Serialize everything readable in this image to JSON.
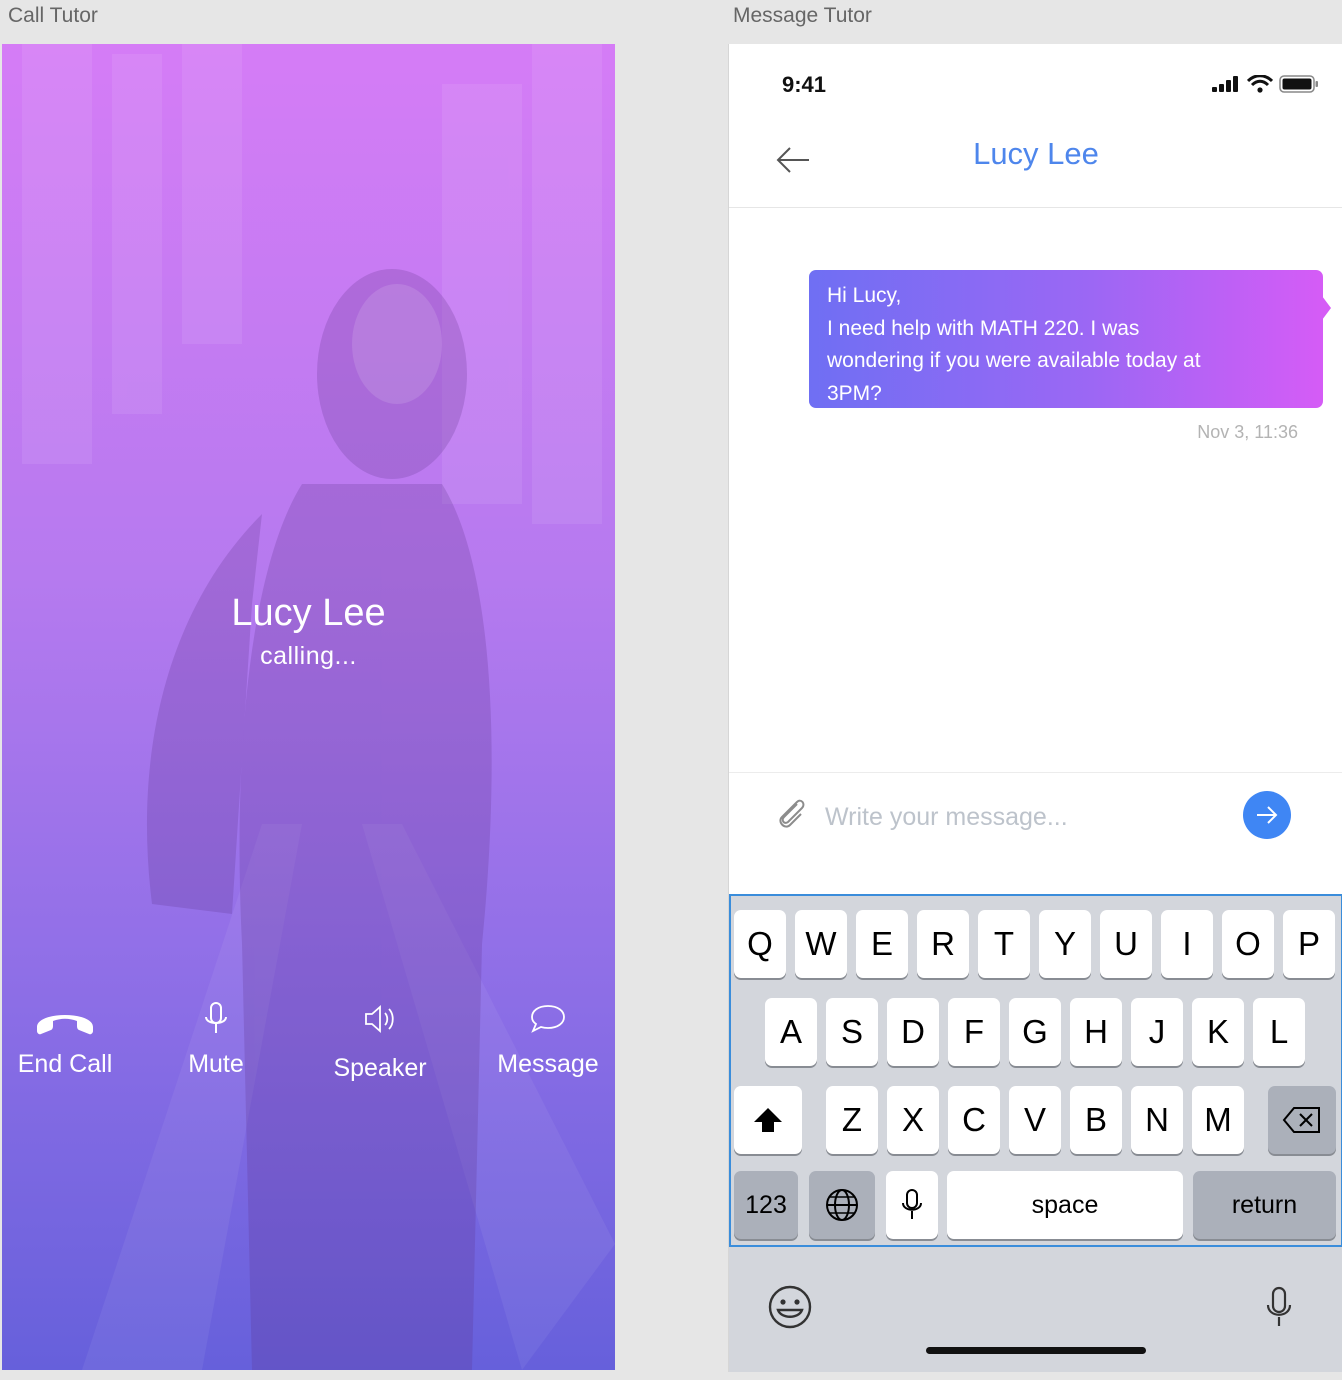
{
  "artboards": {
    "call_label": "Call Tutor",
    "message_label": "Message Tutor"
  },
  "call": {
    "name": "Lucy Lee",
    "status": "calling...",
    "actions": [
      {
        "label": "End Call",
        "icon": "phone-hangup-icon"
      },
      {
        "label": "Mute",
        "icon": "microphone-icon"
      },
      {
        "label": "Speaker",
        "icon": "speaker-icon"
      },
      {
        "label": "Message",
        "icon": "chat-bubble-icon"
      }
    ],
    "gradient_top": "#d57cf6",
    "gradient_bottom": "#6660db"
  },
  "message": {
    "status_time": "9:41",
    "title": "Lucy Lee",
    "bubble_lines": [
      "Hi Lucy,",
      "I need help with MATH 220. I was",
      "wondering if you were available today at",
      "3PM?"
    ],
    "timestamp": "Nov 3, 11:36",
    "composer_placeholder": "Write your message...",
    "accent": "#4e86ec",
    "send_color": "#3f86f4"
  },
  "keyboard": {
    "row1": [
      "Q",
      "W",
      "E",
      "R",
      "T",
      "Y",
      "U",
      "I",
      "O",
      "P"
    ],
    "row2": [
      "A",
      "S",
      "D",
      "F",
      "G",
      "H",
      "J",
      "K",
      "L"
    ],
    "row3": [
      "Z",
      "X",
      "C",
      "V",
      "B",
      "N",
      "M"
    ],
    "numbers_label": "123",
    "space_label": "space",
    "return_label": "return"
  }
}
